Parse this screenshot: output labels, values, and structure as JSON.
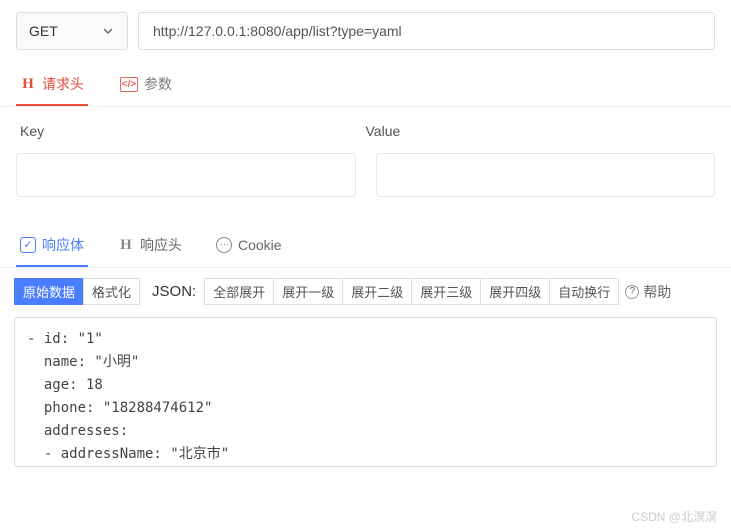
{
  "method": "GET",
  "url": "http://127.0.0.1:8080/app/list?type=yaml",
  "reqTabs": {
    "headers": "请求头",
    "params": "参数"
  },
  "kv": {
    "keyLabel": "Key",
    "valueLabel": "Value"
  },
  "respTabs": {
    "body": "响应体",
    "headers": "响应头",
    "cookie": "Cookie"
  },
  "toolbar": {
    "raw": "原始数据",
    "format": "格式化",
    "jsonLabel": "JSON:",
    "expandAll": "全部展开",
    "expand1": "展开一级",
    "expand2": "展开二级",
    "expand3": "展开三级",
    "expand4": "展开四级",
    "wrap": "自动换行",
    "help": "帮助"
  },
  "yaml": "- id: \"1\"\n  name: \"小明\"\n  age: 18\n  phone: \"18288474612\"\n  addresses:\n  - addressName: \"北京市\"",
  "watermark": "CSDN @北溟溟"
}
